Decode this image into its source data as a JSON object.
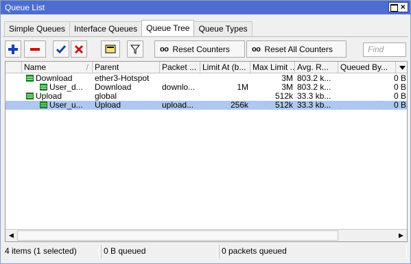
{
  "window": {
    "title": "Queue List"
  },
  "tabs": [
    {
      "label": "Simple Queues",
      "active": false
    },
    {
      "label": "Interface Queues",
      "active": false
    },
    {
      "label": "Queue Tree",
      "active": true
    },
    {
      "label": "Queue Types",
      "active": false
    }
  ],
  "toolbar": {
    "add_icon": "plus-icon",
    "remove_icon": "minus-icon",
    "enable_icon": "check-icon",
    "disable_icon": "x-icon",
    "comment_icon": "comment-icon",
    "filter_icon": "filter-icon",
    "counter_icon_text": "oo",
    "reset_counters": "Reset Counters",
    "reset_all_counters": "Reset All Counters",
    "find_placeholder": "Find"
  },
  "table": {
    "columns": [
      "Name",
      "Parent",
      "Packet ...",
      "Limit At (b...",
      "Max Limit ...",
      "Avg. R...",
      "Queued By..."
    ],
    "sort_indicator": "/",
    "rows": [
      {
        "name": "Download",
        "parent": "ether3-Hotspot",
        "packet": "",
        "limit_at": "",
        "max_limit": "3M",
        "avg_rate": "803.2 k...",
        "queued": "0 B",
        "level": 0,
        "selected": false
      },
      {
        "name": "User_d...",
        "parent": "Download",
        "packet": "downlo...",
        "limit_at": "1M",
        "max_limit": "3M",
        "avg_rate": "803.2 k...",
        "queued": "0 B",
        "level": 1,
        "selected": false
      },
      {
        "name": "Upload",
        "parent": "global",
        "packet": "",
        "limit_at": "",
        "max_limit": "512k",
        "avg_rate": "33.3 kb...",
        "queued": "0 B",
        "level": 0,
        "selected": false
      },
      {
        "name": "User_u...",
        "parent": "Upload",
        "packet": "upload...",
        "limit_at": "256k",
        "max_limit": "512k",
        "avg_rate": "33.3 kb...",
        "queued": "0 B",
        "level": 1,
        "selected": true
      }
    ]
  },
  "status": {
    "items": "4 items (1 selected)",
    "queued": "0 B queued",
    "packets": "0 packets queued"
  },
  "colors": {
    "titlebar": "#4d6dd1",
    "selection": "#a9c4ee",
    "queue_icon": "#1e9a2a",
    "add": "#1a3fb0",
    "remove": "#cc1010"
  }
}
